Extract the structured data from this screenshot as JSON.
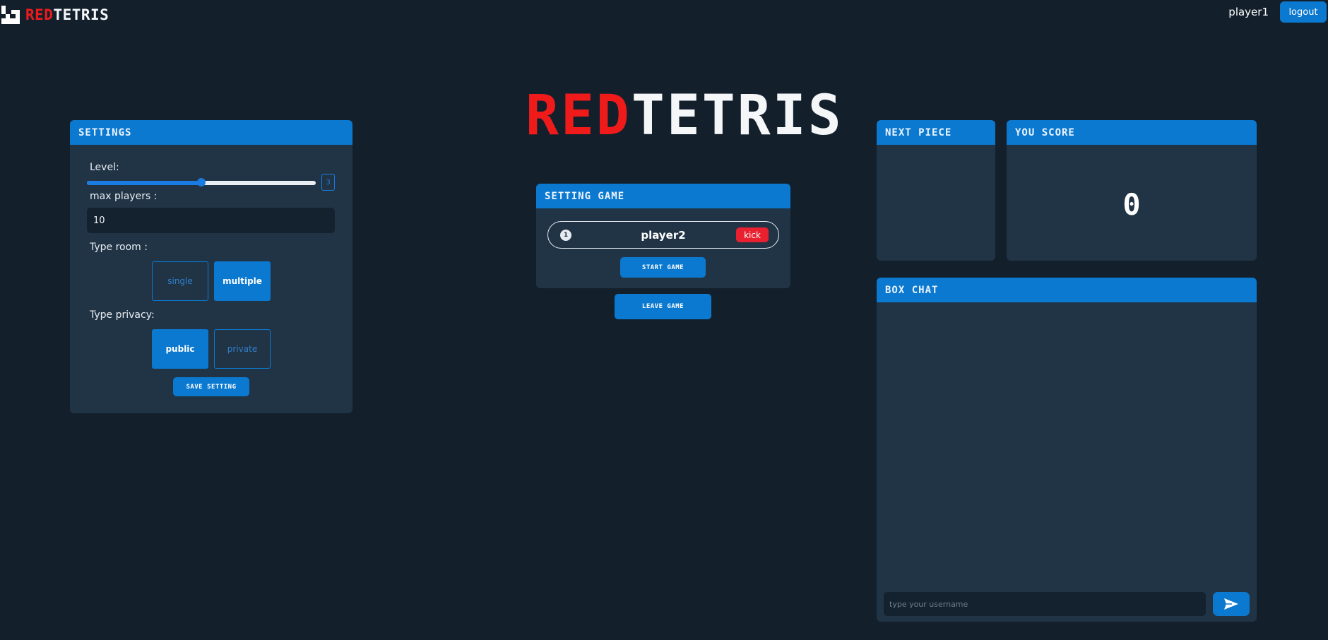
{
  "topbar": {
    "logo_red": "RED",
    "logo_white": "TETRIS",
    "username": "player1",
    "logout_label": "logout"
  },
  "title": {
    "red": "RED",
    "white": "TETRIS"
  },
  "settings": {
    "header": "SETTINGS",
    "level_label": "Level:",
    "level_value": "3",
    "level_fraction": 0.5,
    "max_players_label": "max players :",
    "max_players_value": "10",
    "type_room_label": "Type room :",
    "room_options": [
      "single",
      "multiple"
    ],
    "room_selected": "multiple",
    "type_privacy_label": "Type privacy:",
    "privacy_options": [
      "public",
      "private"
    ],
    "privacy_selected": "public",
    "save_label": "SAVE SETTING"
  },
  "setting_game": {
    "header": "SETTING GAME",
    "players": [
      {
        "index": "1",
        "name": "player2",
        "action": "kick"
      }
    ],
    "start_label": "START GAME",
    "leave_label": "LEAVE GAME"
  },
  "next_piece": {
    "header": "NEXT PIECE"
  },
  "score": {
    "header": "YOU SCORE",
    "value": "0"
  },
  "chat": {
    "header": "BOX CHAT",
    "placeholder": "type your username"
  },
  "colors": {
    "background": "#13202c",
    "panel": "#213446",
    "accent": "#0b79d0",
    "brand_red": "#ef1b1b",
    "kick_red": "#e8202f"
  }
}
